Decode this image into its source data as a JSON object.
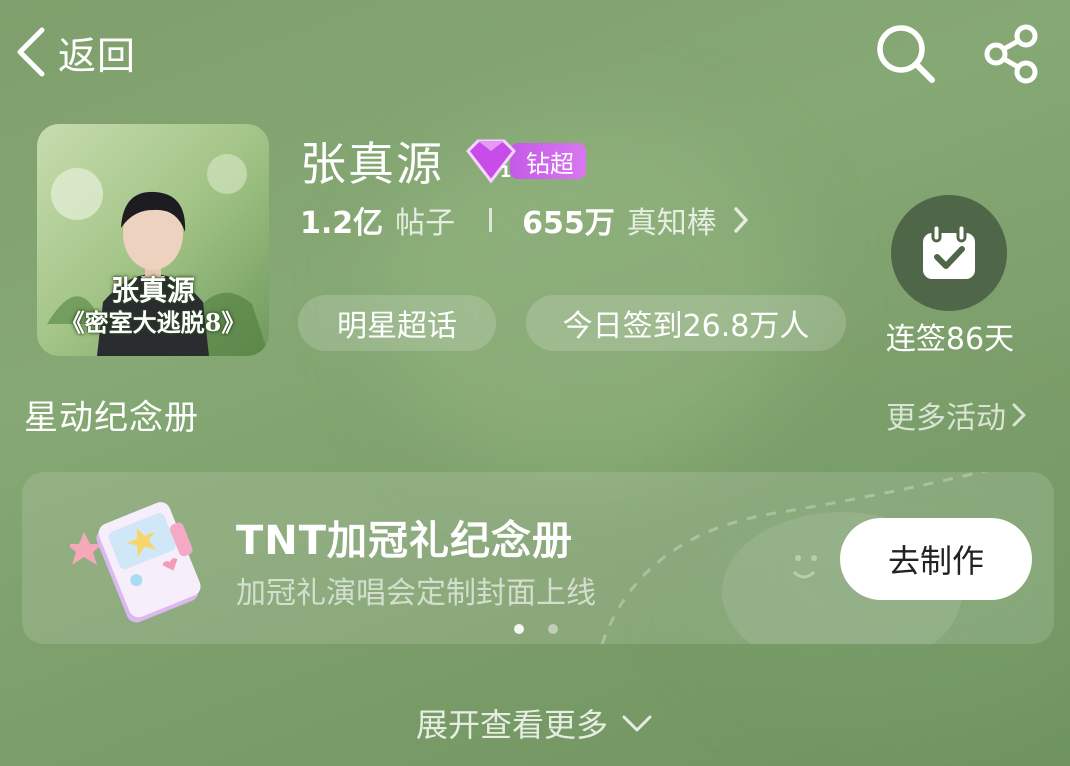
{
  "topbar": {
    "back_label": "返回",
    "back_icon": "chevron-left-icon",
    "search_icon": "search-icon",
    "share_icon": "share-icon"
  },
  "header": {
    "name": "张真源",
    "badge": {
      "icon": "diamond-icon",
      "level": "1",
      "label": "钻超"
    },
    "avatar_caption_line1": "张真源",
    "avatar_caption_line2": "《密室大逃脱8》",
    "posts_count": "1.2亿",
    "posts_unit": "帖子",
    "fans_count": "655万",
    "fans_unit": "真知棒",
    "tags": [
      "明星超话",
      "今日签到26.8万人"
    ],
    "checkin_label": "连签86天",
    "checkin_icon": "calendar-check-icon"
  },
  "section": {
    "title": "星动纪念册",
    "more_label": "更多活动"
  },
  "card": {
    "title": "TNT加冠礼纪念册",
    "subtitle": "加冠礼演唱会定制封面上线",
    "button_label": "去制作",
    "page_count": 2,
    "active_page": 1
  },
  "footer": {
    "expand_label": "展开查看更多"
  },
  "colors": {
    "background": "#7f9f6c",
    "badge": "#c45ae8",
    "checkin_bg": "#4f6648"
  }
}
